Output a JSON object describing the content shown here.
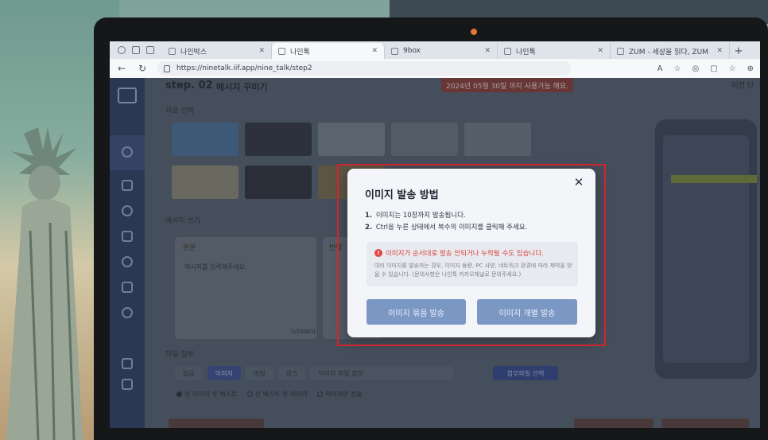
{
  "browser": {
    "tabs": [
      {
        "label": "나인박스",
        "active": false
      },
      {
        "label": "나인톡",
        "active": true
      },
      {
        "label": "9box",
        "active": false
      },
      {
        "label": "나인톡",
        "active": false
      },
      {
        "label": "ZUM - 세상을 읽다, ZUM",
        "active": false
      }
    ],
    "url": "https://ninetalk.iif.app/nine_talk/step2"
  },
  "page": {
    "step_label": "step. 02",
    "step_title": "메시지 꾸미기",
    "notice": "2024년 05월 30일 까지 사용가능 해요.",
    "prev_button": "이전 단",
    "section_images": "자료 선택",
    "section_message": "메시지 쓰기",
    "message_tab": "본문",
    "message_tab_2": "반영",
    "message_placeholder": "메시지를 입력해주세요.",
    "message_counter": "0/2000자",
    "section_file": "파일 첨부",
    "file_tabs": [
      "없음",
      "이미지",
      "파일",
      "링크"
    ],
    "file_input_label": "이미지 파일 첨부",
    "file_select_button": "첨부파일 선택",
    "radio_options": [
      {
        "label": "선 이미지 후 텍스트",
        "checked": true
      },
      {
        "label": "선 텍스트 후 이미지",
        "checked": false
      },
      {
        "label": "이미지만 전송",
        "checked": false
      }
    ]
  },
  "modal": {
    "title": "이미지 발송 방법",
    "steps": [
      {
        "num": "1.",
        "text": "이미지는 10장까지 발송됩니다."
      },
      {
        "num": "2.",
        "text": "Ctrl을 누른 상태에서 복수의 이미지를 클릭해 주세요."
      }
    ],
    "warning_title": "이미지가 순서대로 발송 안되거나 누락될 수도 있습니다.",
    "warning_body": "여러 이미지를 발송하는 경우, 이미지 용량, PC 사양, 네트워크 환경에 따라 제약을 받을 수 있습니다. (문의사항은 나인톡 카카오채널로 문의주세요.)",
    "button_bundle": "이미지 묶음 발송",
    "button_individual": "이미지 개별 발송",
    "close_icon": "close-icon"
  },
  "colors": {
    "highlight": "#d0252b",
    "modal_button": "#7b97c4",
    "warning": "#d8443f"
  }
}
